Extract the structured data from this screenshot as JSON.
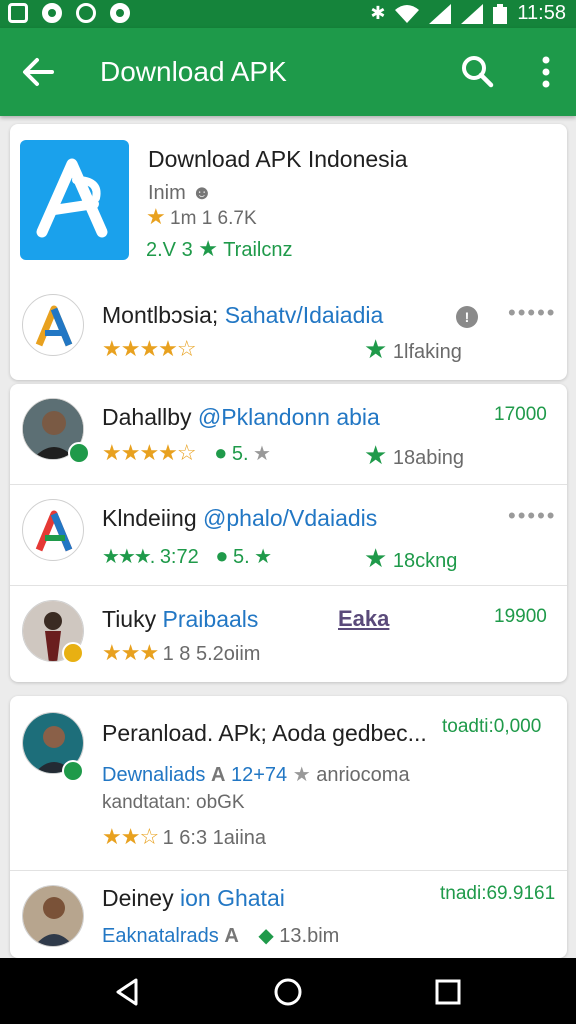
{
  "status_bar": {
    "time": "11:58"
  },
  "app_bar": {
    "title": "Download APK"
  },
  "featured": {
    "title": "Download APK Indonesia",
    "line1": "Inim",
    "rating_text": "1m 1 6.7K",
    "meta": "2.V 3",
    "tag": "Trailcnz"
  },
  "items": [
    {
      "title": "Montlbɔsia;",
      "handle": "Sahatv/Idaiadia",
      "right_text": "1lfaking",
      "stars": 3.5
    },
    {
      "title": "Dahallby",
      "handle": "@Pklandonn abia",
      "badge_text": "5.",
      "right_text": "18abing",
      "count": "17000",
      "stars": 4.5
    },
    {
      "title": "Klndeiing",
      "handle": "@phalo/Vdaiadis",
      "rating_text": "3:72",
      "badge_text": "5.",
      "right_text": "18ckng"
    },
    {
      "title": "Tiuky",
      "handle": "Praibaals",
      "link": "Eaka",
      "rating_text": "1 8 5.2oiim",
      "count": "19900",
      "stars": 3
    }
  ],
  "downloads": [
    {
      "title": "Peranload. APk; Aoda gedbec...",
      "count": "toadti:0,000",
      "sub": "Dewnaliads",
      "sub2": "12+74",
      "sub3": "anriocoma",
      "size": "kandtatan: obGK",
      "rating_text": "1 6:3 1aiina",
      "stars": 2.5
    },
    {
      "title": "Deiney",
      "title_blue": "ion Ghatai",
      "count": "tnadi:69.9161",
      "sub": "Eaknatalrads",
      "rating_text": "13.bim"
    }
  ],
  "colors": {
    "status_bar": "#15843b",
    "app_bar": "#1e9a4a",
    "accent_green": "#1f9a4a",
    "link_blue": "#2277c4",
    "star_orange": "#e8a11f"
  }
}
